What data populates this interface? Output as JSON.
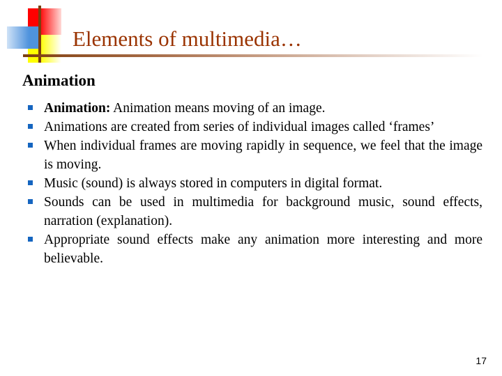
{
  "slide": {
    "title": "Elements of multimedia…",
    "subheading": "Animation",
    "page_number": "17",
    "colors": {
      "title": "#9a3300",
      "bullet": "#1565c0",
      "logo_red": "#ff0000",
      "logo_yellow": "#ffff00",
      "logo_blue": "#4f93dd",
      "logo_bar": "#7b3f10",
      "body_text": "#000000"
    },
    "bullets": [
      {
        "lead": "Animation:",
        "text": " Animation means moving of an image.",
        "justify": false
      },
      {
        "lead": "",
        "text": "Animations are created from series of individual images called ‘frames’",
        "justify": false
      },
      {
        "lead": "",
        "text": "When individual frames are moving rapidly in sequence, we feel that the image is moving.",
        "justify": true
      },
      {
        "lead": "",
        "text": "Music (sound) is always stored in computers in digital format.",
        "justify": false
      },
      {
        "lead": "",
        "text": "Sounds can be used in multimedia for background music, sound effects, narration (explanation).",
        "justify": true
      },
      {
        "lead": "",
        "text": "Appropriate sound effects make any animation more interesting and more believable.",
        "justify": true
      }
    ]
  }
}
